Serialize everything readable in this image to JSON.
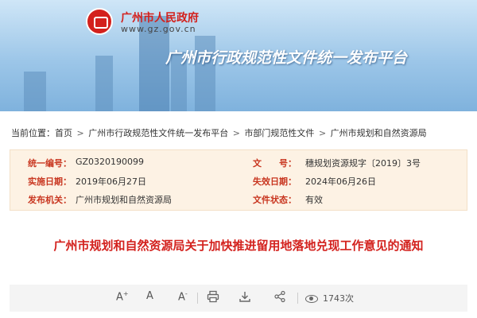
{
  "banner": {
    "site_name": "广州市人民政府",
    "site_url": "www.gz.gov.cn",
    "platform_title": "广州市行政规范性文件统一发布平台"
  },
  "breadcrumb": {
    "prefix": "当前位置：",
    "items": [
      "首页",
      "广州市行政规范性文件统一发布平台",
      "市部门规范性文件",
      "广州市规划和自然资源局"
    ],
    "separator": ">"
  },
  "info": {
    "serial_label": "统一编号：",
    "serial_value": "GZ0320190099",
    "doc_no_label": "文　　号：",
    "doc_no_value": "穗规划资源规字〔2019〕3号",
    "effective_label": "实施日期：",
    "effective_value": "2019年06月27日",
    "expire_label": "失效日期：",
    "expire_value": "2024年06月26日",
    "issuer_label": "发布机关：",
    "issuer_value": "广州市规划和自然资源局",
    "status_label": "文件状态：",
    "status_value": "有效"
  },
  "document": {
    "title": "广州市规划和自然资源局关于加快推进留用地落地兑现工作意见的通知"
  },
  "toolbar": {
    "font_increase": "A",
    "font_increase_sup": "+",
    "font_default": "A",
    "font_decrease": "A",
    "font_decrease_sup": "-",
    "views": "1743次"
  },
  "colors": {
    "accent_red": "#d3211d",
    "label_red": "#c8351f",
    "info_bg": "#fdf2e4"
  }
}
